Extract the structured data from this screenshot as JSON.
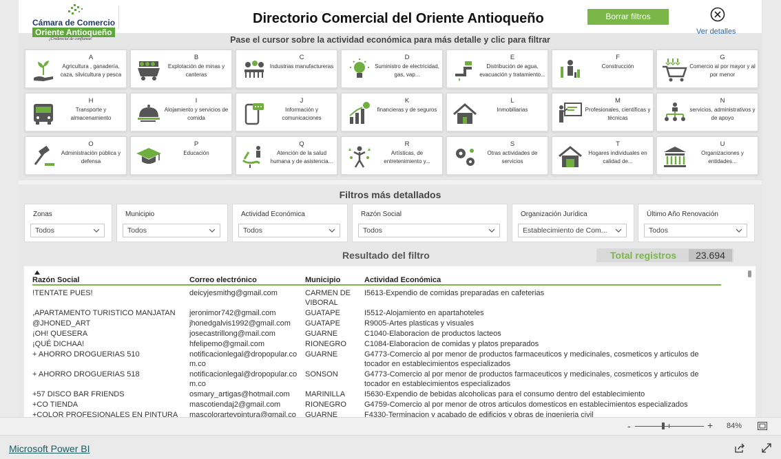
{
  "header": {
    "logo_line1": "Cámara de Comercio",
    "logo_line2": "Oriente Antioqueño",
    "logo_tagline": "¡Credencial de confianza!",
    "title": "Directorio Comercial del Oriente Antioqueño",
    "clear_filters": "Borrar filtros",
    "details_link": "Ver detalles"
  },
  "subtitle": "Pase el cursor sobre la actividad económica para más detalle y clic para filtrar",
  "activities": [
    {
      "letter": "A",
      "name": "Agricultura , ganadería, caza, silvicultura y pesca",
      "icon": "plant-hand-icon"
    },
    {
      "letter": "B",
      "name": "Explotación de minas y canteras",
      "icon": "mining-cart-icon"
    },
    {
      "letter": "C",
      "name": "Industrias manufactureras",
      "icon": "gears-factory-icon"
    },
    {
      "letter": "D",
      "name": "Suministro de electricidad, gas, vap...",
      "icon": "lightbulb-icon"
    },
    {
      "letter": "E",
      "name": "Distribución de agua, evacuación y tratamiento...",
      "icon": "water-tap-icon"
    },
    {
      "letter": "F",
      "name": "Construcción",
      "icon": "construction-worker-icon"
    },
    {
      "letter": "G",
      "name": "Comercio al por mayor y al por menor",
      "icon": "shopping-cart-icon"
    },
    {
      "letter": "H",
      "name": "Transporte y almacenamiento",
      "icon": "bus-icon"
    },
    {
      "letter": "I",
      "name": "Alojamiento y servicios de comida",
      "icon": "food-cloche-icon"
    },
    {
      "letter": "J",
      "name": "Información y comunicaciones",
      "icon": "smartphone-chat-icon"
    },
    {
      "letter": "K",
      "name": "financieras y de seguros",
      "icon": "finance-chart-icon"
    },
    {
      "letter": "L",
      "name": "Inmobiliarias",
      "icon": "house-icon"
    },
    {
      "letter": "M",
      "name": "Profesionales, científicas y técnicas",
      "icon": "presentation-icon"
    },
    {
      "letter": "N",
      "name": "servicios, administrativos y de apoyo",
      "icon": "org-chart-icon"
    },
    {
      "letter": "O",
      "name": "Administración pública y defensa",
      "icon": "gavel-icon"
    },
    {
      "letter": "P",
      "name": "Educación",
      "icon": "graduation-cap-icon"
    },
    {
      "letter": "Q",
      "name": "Atención de la salud humana y de asistencia...",
      "icon": "dentist-chair-icon"
    },
    {
      "letter": "R",
      "name": "Artísticas, de entretenimiento y...",
      "icon": "artist-figure-icon"
    },
    {
      "letter": "S",
      "name": "Otras actividades de servicios",
      "icon": "service-gears-icon"
    },
    {
      "letter": "T",
      "name": "Hogares individuales en calidad de...",
      "icon": "household-icon"
    },
    {
      "letter": "U",
      "name": "Organizaciones y entidades...",
      "icon": "institution-building-icon"
    }
  ],
  "filters_title": "Filtros más detallados",
  "filters": [
    {
      "label": "Zonas",
      "value": "Todos"
    },
    {
      "label": "Municipio",
      "value": "Todos"
    },
    {
      "label": "Actividad Económica",
      "value": "Todos"
    },
    {
      "label": "Razón Social",
      "value": "Todos"
    },
    {
      "label": "Organización Jurídica",
      "value": "Establecimiento de Com..."
    },
    {
      "label": "Último Año Renovación",
      "value": "Todos"
    }
  ],
  "results": {
    "title": "Resultado del filtro",
    "total_label": "Total registros",
    "total_value": "23.694"
  },
  "table": {
    "columns": [
      "Razón Social",
      "Correo electrónico",
      "Municipio",
      "Actividad Económica"
    ],
    "rows": [
      [
        "!TENTATE PUES!",
        "deicyjesmithg@gmail.com",
        "CARMEN DE VIBORAL",
        "I5613-Expendio de comidas preparadas en cafeterias"
      ],
      [
        ",APARTAMENTO TURISTICO MANJATAN",
        "jeronimor742@gmail.com",
        "GUATAPE",
        "I5512-Alojamiento en apartahoteles"
      ],
      [
        "@JHONED_ART",
        "jhonedgalvis1992@gmail.com",
        "GUATAPE",
        "R9005-Artes plasticas y visuales"
      ],
      [
        "¡OH! QUESERA",
        "josecastrillong@mail.com",
        "GUARNE",
        "C1040-Elaboracion de productos lacteos"
      ],
      [
        "¡QUÉ DICHAA!",
        "hfelipemo@gmail.com",
        "RIONEGRO",
        "C1084-Elaboracion de comidas y platos preparados"
      ],
      [
        "+ AHORRO DROGUERIAS 510",
        "notificacionlegal@dropopular.com.co",
        "GUARNE",
        "G4773-Comercio al por menor de productos farmaceuticos y medicinales, cosmeticos y articulos de tocador en establecimientos especializados"
      ],
      [
        "+ AHORRO DROGUERIAS 518",
        "notificacionlegal@dropopular.com.co",
        "SONSON",
        "G4773-Comercio al por menor de productos farmaceuticos y medicinales, cosmeticos y articulos de tocador en establecimientos especializados"
      ],
      [
        "+57 DISCO BAR FRIENDS",
        "osmary_artigas@hotmail.com",
        "MARINILLA",
        "I5630-Expendio de bebidas alcoholicas para el consumo dentro del establecimiento"
      ],
      [
        "+CO TIENDA",
        "mascotiendaj2@gmail.com",
        "RIONEGRO",
        "G4759-Comercio al por menor de otros articulos domesticos en establecimientos especializados"
      ],
      [
        "+COLOR PROFESIONALES EN PINTURA",
        "mascolorartevpintura@gmail.co",
        "GUARNE",
        "F4330-Terminacion y acabado de edificios y obras de ingenieria civil"
      ]
    ]
  },
  "zoom": {
    "minus": "-",
    "plus": "+",
    "percent": "84%"
  },
  "footer": {
    "brand_link": "Microsoft Power BI"
  },
  "colors": {
    "accent_green": "#7ab648",
    "brand_blue": "#1d3a70",
    "link_teal": "#1a5b63"
  }
}
